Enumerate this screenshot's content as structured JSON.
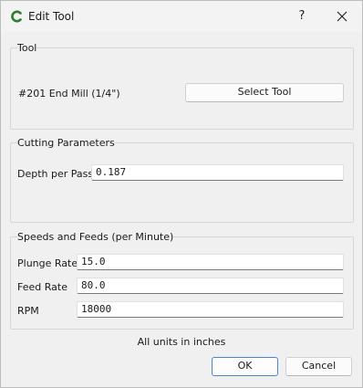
{
  "window": {
    "title": "Edit Tool",
    "help_label": "?",
    "icons": {
      "app": "app-logo-icon",
      "close": "close-icon"
    },
    "accent_color": "#2e7d32"
  },
  "tool_group": {
    "title": "Tool",
    "tool_name": "#201 End Mill (1/4\")",
    "select_button": "Select Tool"
  },
  "cutting_group": {
    "title": "Cutting Parameters",
    "depth_label": "Depth per Pass",
    "depth_value": "0.187"
  },
  "speeds_group": {
    "title": "Speeds and Feeds (per Minute)",
    "plunge_label": "Plunge Rate",
    "plunge_value": "15.0",
    "feed_label": "Feed Rate",
    "feed_value": "80.0",
    "rpm_label": "RPM",
    "rpm_value": "18000"
  },
  "footer": {
    "units_note": "All units in inches",
    "ok_button": "OK",
    "cancel_button": "Cancel"
  }
}
